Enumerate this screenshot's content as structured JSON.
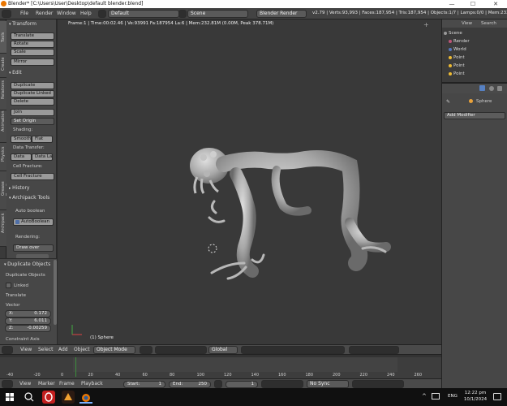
{
  "titlebar": {
    "title": "Blender* [C:\\Users\\User\\Desktop\\default blender.blend]",
    "minimize": "—",
    "maximize": "☐",
    "close": "✕"
  },
  "infobar": {
    "menus": [
      "File",
      "Render",
      "Window",
      "Help"
    ],
    "layout": "Default",
    "scene": "Scene",
    "engine": "Blender Render",
    "stats": "v2.79 | Verts:93,993 | Faces:187,954 | Tris:187,954 | Objects:1/7 | Lamps:0/0 | Mem:232.8M"
  },
  "tabs": [
    "Tools",
    "Create",
    "Relations",
    "Animation",
    "Physics",
    "Grease Pencil",
    "Archipack"
  ],
  "toolshelf": {
    "transform_header": "Transform",
    "transform": [
      "Translate",
      "Rotate",
      "Scale"
    ],
    "mirror": "Mirror",
    "edit_header": "Edit",
    "edit": [
      "Duplicate",
      "Duplicate Linked",
      "Delete"
    ],
    "join": "Join",
    "set_origin": "Set Origin",
    "shading_label": "Shading:",
    "shading": [
      "Smooth",
      "Flat"
    ],
    "data_transfer_label": "Data Transfer:",
    "data_transfer": [
      "Data",
      "Data La"
    ],
    "cell_fracture_label": "Cell Fracture:",
    "cell_fracture": "Cell Fracture",
    "history_header": "History",
    "archipack_header": "Archipack Tools",
    "auto_boolean": "Auto boolean",
    "autoboolean_btn": "AutoBoolean",
    "rendering_label": "Rendering:",
    "draw_over": "Draw over"
  },
  "operator": {
    "header": "Duplicate Objects",
    "sub": "Duplicate Objects",
    "linked": "Linked",
    "translate": "Translate",
    "vector": "Vector",
    "x_label": "X:",
    "x": "0.172",
    "y_label": "Y:",
    "y": "6.011",
    "z_label": "Z:",
    "z": "-0.00259",
    "constraint": "Constraint Axis"
  },
  "viewport": {
    "info": "Frame:1 | Time:00:02.46 | Ve:93991 Fa:187954 La:6 | Mem:232.81M (0.00M, Peak 378.71M)",
    "object": "(1) Sphere"
  },
  "outliner": {
    "view": "View",
    "search": "Search",
    "items": [
      "Scene",
      "Render",
      "World",
      "Point",
      "Point",
      "Point"
    ]
  },
  "properties": {
    "object": "Sphere",
    "add_modifier": "Add Modifier"
  },
  "view3d_header": {
    "menus": [
      "View",
      "Select",
      "Add",
      "Object"
    ],
    "mode": "Object Mode",
    "orientation": "Global"
  },
  "timeline": {
    "ticks": [
      "-40",
      "-20",
      "0",
      "20",
      "40",
      "60",
      "80",
      "100",
      "120",
      "140",
      "160",
      "180",
      "200",
      "220",
      "240",
      "260",
      "280"
    ],
    "menus": [
      "View",
      "Marker",
      "Frame",
      "Playback"
    ],
    "start_label": "Start:",
    "start": "1",
    "end_label": "End:",
    "end": "250",
    "current": "1",
    "sync": "No Sync"
  },
  "taskbar": {
    "lang": "ENG",
    "time": "12:22 pm",
    "date": "10/1/2024"
  },
  "colors": {
    "accent": "#5680c2",
    "blender_orange": "#ea7600",
    "playhead": "#3c8f3c"
  }
}
